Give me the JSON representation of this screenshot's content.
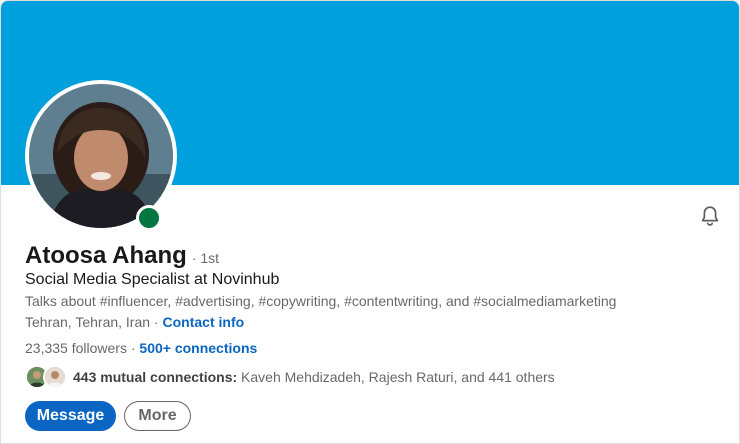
{
  "profile": {
    "name": "Atoosa Ahang",
    "degree": "· 1st",
    "headline": "Social Media Specialist at Novinhub",
    "talks_about": "Talks about #influencer, #advertising, #copywriting, #contentwriting, and #socialmediamarketing",
    "location": "Tehran, Tehran, Iran",
    "location_sep": " · ",
    "contact_info": "Contact info",
    "followers": "23,335 followers",
    "connections_sep": " · ",
    "connections": "500+ connections",
    "mutual_label": "443 mutual connections:",
    "mutual_names": " Kaveh Mehdizadeh, Rajesh Raturi, and 441 others"
  },
  "actions": {
    "message_label": "Message",
    "more_label": "More"
  },
  "icons": {
    "notification": "bell-icon",
    "online_status": "online-status-dot"
  },
  "colors": {
    "banner": "#00a0dc",
    "primary": "#0a66c2",
    "online": "#057642"
  }
}
